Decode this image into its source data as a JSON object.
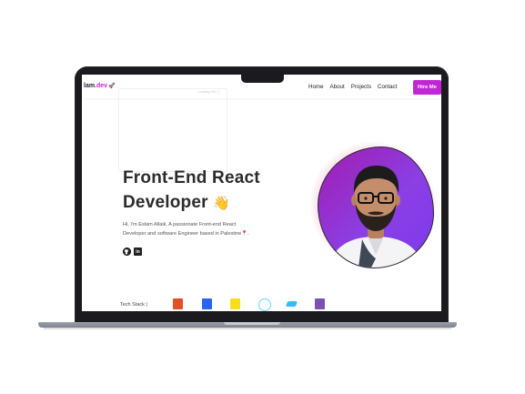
{
  "brand": {
    "logo_text": "lam",
    "logo_suffix": ".dev",
    "logo_icon": "rocket-icon",
    "accent_color": "#c026d3"
  },
  "nav": {
    "items": [
      {
        "label": "Home"
      },
      {
        "label": "About"
      },
      {
        "label": "Projects"
      },
      {
        "label": "Contact"
      }
    ],
    "hire_label": "Hire Me"
  },
  "ghost": {
    "text": "Loading 100 ⓘ"
  },
  "hero": {
    "title_line1": "Front-End React",
    "title_line2": "Developer",
    "title_emoji": "👋",
    "desc_line1": "Hi, I'm Eslam Allaik. A passionate Front-end React",
    "desc_line2": "Developer and software Engineer based in Palestine",
    "desc_pin": "📍",
    "desc_end": "."
  },
  "socials": [
    {
      "icon": "github-icon",
      "glyph": "●"
    },
    {
      "icon": "linkedin-icon",
      "glyph": "in"
    }
  ],
  "tech": {
    "label": "Tech Stack |",
    "icons": [
      "html5-icon",
      "css3-icon",
      "javascript-icon",
      "react-icon",
      "tailwind-icon",
      "bootstrap-icon"
    ]
  }
}
